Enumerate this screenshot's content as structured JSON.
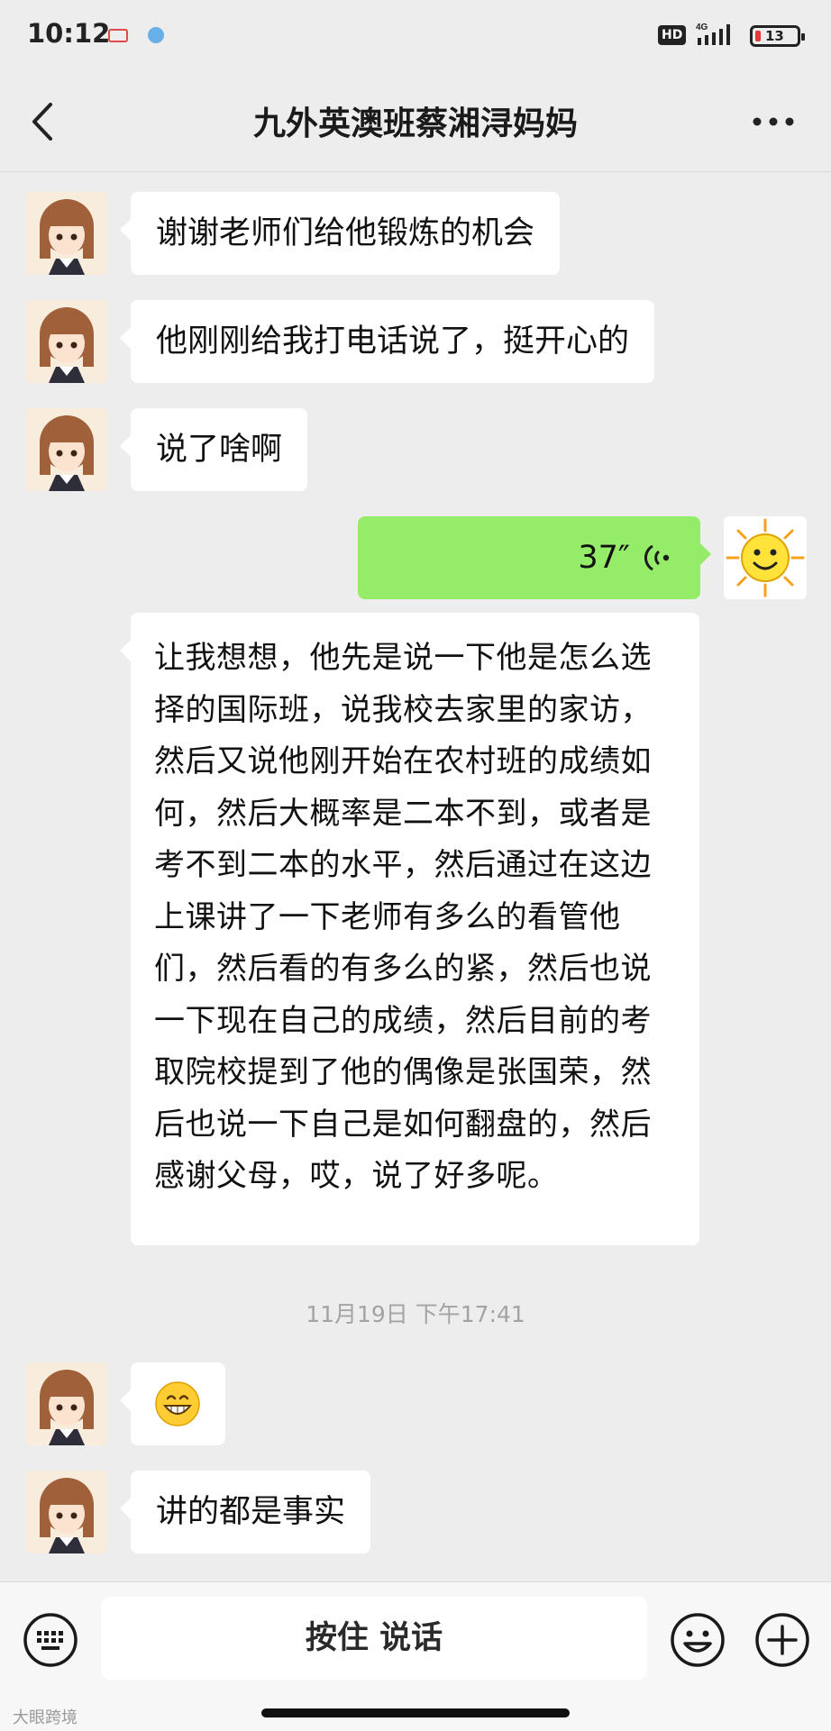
{
  "status_bar": {
    "time": "10:12",
    "network": "4G",
    "hd": "HD",
    "battery": "13"
  },
  "header": {
    "title": "九外英澳班蔡湘浔妈妈"
  },
  "messages": {
    "m1": "谢谢老师们给他锻炼的机会",
    "m2": "他刚刚给我打电话说了，挺开心的",
    "m3": "说了啥啊",
    "voice_duration": "37″",
    "long": "让我想想，他先是说一下他是怎么选择的国际班，说我校去家里的家访，然后又说他刚开始在农村班的成绩如何，然后大概率是二本不到，或者是考不到二本的水平，然后通过在这边上课讲了一下老师有多么的看管他们，然后看的有多么的紧，然后也说一下现在自己的成绩，然后目前的考取院校提到了他的偶像是张国荣，然后也说一下自己是如何翻盘的，然后感谢父母，哎，说了好多呢。",
    "timestamp": "11月19日 下午17:41",
    "emoji": "😁",
    "m6": "讲的都是事实"
  },
  "input_bar": {
    "hold_to_talk": "按住 说话"
  },
  "watermark": "大眼跨境",
  "colors": {
    "background": "#ededed",
    "sent_bubble": "#95ec69",
    "received_bubble": "#ffffff"
  }
}
